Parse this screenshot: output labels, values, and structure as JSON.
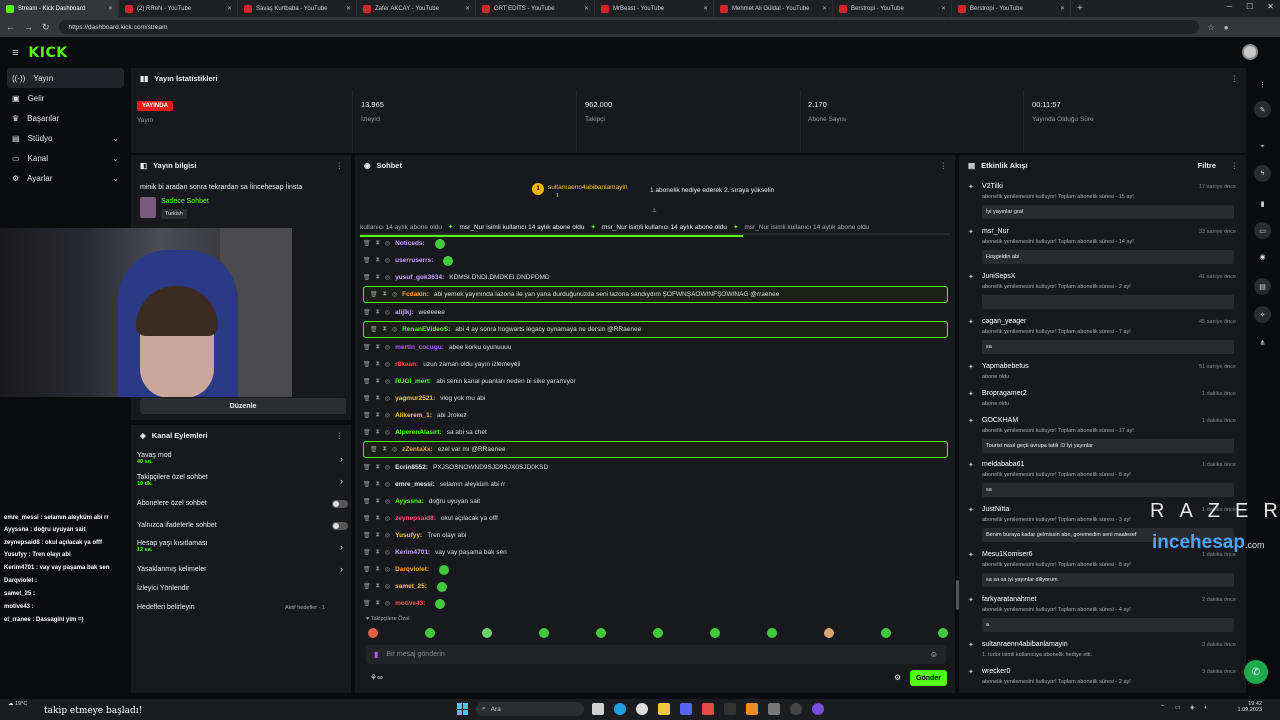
{
  "browser": {
    "tabs": [
      {
        "label": "Stream - Kick Dashboard",
        "active": true
      },
      {
        "label": "(2) RReN - YouTube"
      },
      {
        "label": "Savaş Kurtbaba - YouTube"
      },
      {
        "label": "Zafer AKCAY - YouTube"
      },
      {
        "label": "GRT EDİTS - YouTube"
      },
      {
        "label": "MrBeast - YouTube"
      },
      {
        "label": "Mehmet Ali Güldal - YouTube"
      },
      {
        "label": "Berstropi - YouTube"
      },
      {
        "label": "Berstropi - YouTube"
      }
    ],
    "url": "https://dashboard.kick.com/stream"
  },
  "app": {
    "logo": "KICK"
  },
  "sidebar": {
    "items": [
      {
        "label": "Yayın",
        "icon": "broadcast-icon"
      },
      {
        "label": "Gelir",
        "icon": "money-icon"
      },
      {
        "label": "Başarılar",
        "icon": "trophy-icon"
      },
      {
        "label": "Stüdyo",
        "icon": "studio-icon"
      },
      {
        "label": "Kanal",
        "icon": "channel-icon"
      },
      {
        "label": "Ayarlar",
        "icon": "settings-icon"
      }
    ]
  },
  "stats": {
    "title": "Yayın İstatistikleri",
    "live_badge": "YAYINDA",
    "live_label": "Yayın",
    "viewers": "13.965",
    "viewers_label": "İzleyici",
    "followers": "962.000",
    "followers_label": "Takipçi",
    "subs": "2.170",
    "subs_label": "Abone Sayısı",
    "uptime": "00:11:57",
    "uptime_label": "Yayında Olduğu Süre"
  },
  "stream_info": {
    "title": "Yayın bilgisi",
    "stream_title": "minik bi aradan sonra tekrardan sa İincehesap İinsta",
    "category": "Sadece Sohbet",
    "tag": "Turkish",
    "edit_button": "Düzenle"
  },
  "channel_actions": {
    "title": "Kanal Eylemleri",
    "items": [
      {
        "label": "Yavaş mod",
        "sub": "40 sn."
      },
      {
        "label": "Takipçilere özel sohbet",
        "sub": "10 dk."
      },
      {
        "label": "Abonelere özel sohbet",
        "sub": ""
      },
      {
        "label": "Yalnızca ifadelerle sohbet",
        "sub": ""
      },
      {
        "label": "Hesap yaşı kısıtlaması",
        "sub": "12 sa."
      },
      {
        "label": "Yasaklanmış kelimeler",
        "sub": ""
      },
      {
        "label": "İzleyici Yönlendir",
        "sub": ""
      },
      {
        "label": "Hedefleri belirleyin",
        "sub": ""
      }
    ],
    "goals_status": "Aktif hedefler · 1"
  },
  "chat": {
    "title": "Sohbet",
    "pinned_user": "sultanraenn4abibanlamayin",
    "pinned_count": "1",
    "pinned_text": "1 abonelik hediye ederek 2. sıraya yükselin",
    "ticker": [
      "kullanıcı 14 aylık abone oldu",
      "msr_Nur isimli kullanıcı 14 aylık abone oldu",
      "msr_Nur isimli kullanıcı 14 aylık abone oldu",
      "msr_Nur isimli kullanıcı 14 aylık abone oldu"
    ],
    "messages": [
      {
        "user": "Noticeds:",
        "text": "",
        "color": "#c9a2ff"
      },
      {
        "user": "userruserrs:",
        "text": "",
        "color": "#c9a2ff"
      },
      {
        "user": "yusuf_gok3634:",
        "text": "KDMSI.DNDI.DMDKEI.DNDPDMD",
        "color": "#c9a2ff"
      },
      {
        "user": "Fcdakin:",
        "text": "abi yemek yayınında lazona ile yan yana durduğunuzda seni lazona sandıydım ŞOFWNŞAOWINFŞOWINAG @rraenee",
        "color": "#f4a742",
        "hl": true
      },
      {
        "user": "alijlkj:",
        "text": "weeeeee",
        "color": "#c9a2ff"
      },
      {
        "user": "RenanEVideoS:",
        "text": "abi 4 ay sonra hogwarts legacy oynamaya ne dersin @RRaenee",
        "color": "#53fc18",
        "hl": true
      },
      {
        "user": "mertin_cocugu:",
        "text": "abee korku oyunuuuu",
        "color": "#b05cff"
      },
      {
        "user": "r8kaan:",
        "text": "uzun zaman oldu yayın izlemeyeli",
        "color": "#ff4d4d"
      },
      {
        "user": "RUGI_mert:",
        "text": "abi senin kanal puanları neden bi sike yaramıyor",
        "color": "#53fc18"
      },
      {
        "user": "yagmur2521:",
        "text": "vlog yok mu abi",
        "color": "#f4c542"
      },
      {
        "user": "Alikerem_1:",
        "text": "abi Jrokez",
        "color": "#f4c542"
      },
      {
        "user": "AlperenAlasirt:",
        "text": "sa abi sa chet",
        "color": "#53fc18"
      },
      {
        "user": "zZentaXx:",
        "text": "ezel var mı @RRaenee",
        "color": "#f4a742",
        "hl": true
      },
      {
        "user": "Ecrin8552:",
        "text": "PXJSOSNOWND9SJD9SJX0SJD0KSD",
        "color": "#e8e8e8"
      },
      {
        "user": "emre_messi:",
        "text": "selamın aleyküm abi rr",
        "color": "#e8e8e8"
      },
      {
        "user": "Ayyssna:",
        "text": "doğru uyuyan sait",
        "color": "#53fc18"
      },
      {
        "user": "zeynepsaid8:",
        "text": "okul açılacak ya offf",
        "color": "#ff4d7a"
      },
      {
        "user": "Yusufyy:",
        "text": "Tren olayı abi",
        "color": "#f4c542"
      },
      {
        "user": "Kerim4701:",
        "text": "vay vay paşama bak sen",
        "color": "#c9a2ff"
      },
      {
        "user": "Darqviolet:",
        "text": "",
        "color": "#f4a742"
      },
      {
        "user": "samet_25:",
        "text": "",
        "color": "#f4c542"
      },
      {
        "user": "motive43:",
        "text": "",
        "color": "#ff4d4d"
      }
    ],
    "followers_only": "Takipçilere Özel",
    "input_placeholder": "Bir mesaj gönderin",
    "send_button": "Gönder"
  },
  "events": {
    "title": "Etkinlik Akışı",
    "filter": "Filtre",
    "items": [
      {
        "name": "V2Tilki",
        "time": "17 saniye önce",
        "desc": "abonelik yenilemesini kutluyor! Toplam abonelik süresi - 15 ay!",
        "msg": "İyi yayınlar gral"
      },
      {
        "name": "msr_Nur",
        "time": "33 saniye önce",
        "desc": "abonelik yenilemesini kutluyor! Toplam abonelik süresi - 14 ay!",
        "msg": "Hoşgeldin abi"
      },
      {
        "name": "JuniSepsX",
        "time": "41 saniye önce",
        "desc": "abonelik yenilemesini kutluyor! Toplam abonelik süresi - 2 ay!",
        "msg": ""
      },
      {
        "name": "cagan_yeager",
        "time": "45 saniye önce",
        "desc": "abonelik yenilemesini kutluyor! Toplam abonelik süresi - 7 ay!",
        "msg": "sa"
      },
      {
        "name": "Yapmabebetus",
        "time": "51 saniye önce",
        "desc": "abone oldu",
        "msg": ""
      },
      {
        "name": "Bropragamer2",
        "time": "1 dakika önce",
        "desc": "abone oldu",
        "msg": ""
      },
      {
        "name": "GOCKHAM",
        "time": "1 dakika önce",
        "desc": "abonelik yenilemesini kutluyor! Toplam abonelik süresi - 17 ay!",
        "msg": "Tourist nasıl geçti avrupa tatili :D İyi yayınlar"
      },
      {
        "name": "meldababa61",
        "time": "1 dakika önce",
        "desc": "abonelik yenilemesini kutluyor! Toplam abonelik süresi - 8 ay!",
        "msg": "sa"
      },
      {
        "name": "JustNitta",
        "time": "1 dakika önce",
        "desc": "abonelik yenilemesini kutluyor! Toplam abonelik süresi - 3 ay!",
        "msg": "Benim buraya kadar gelmissin abe, goremedim seni maalesef"
      },
      {
        "name": "Mesu1Komiser6",
        "time": "1 dakika önce",
        "desc": "abonelik yenilemesini kutluyor! Toplam abonelik süresi - 8 ay!",
        "msg": "sa sa sa iyi yayınlar diliyorum"
      },
      {
        "name": "farkyaratanahmet",
        "time": "2 dakika önce",
        "desc": "abonelik yenilemesini kutluyor! Toplam abonelik süresi - 4 ay!",
        "msg": "a"
      },
      {
        "name": "sultanraenn4abibanlamayin",
        "time": "3 dakika önce",
        "desc": "1. tudor isimli kullanıcıya abonelik hediye etti.",
        "msg": ""
      },
      {
        "name": "wrecker0",
        "time": "3 dakika önce",
        "desc": "abonelik yenilemesini kutluyor! Toplam abonelik süresi - 2 ay!",
        "msg": ""
      }
    ]
  },
  "overlay": {
    "chat": [
      "emre_messi : selamın aleyküm abi rr",
      "Ayyssna : doğru uyuyan sait",
      "zeynepsaid8 : okul açılacak ya offf",
      "Yusufyy : Tren olayı abi",
      "Kerim4701 : vay vay paşama bak sen",
      "Darqviolet :",
      "samet_25 :",
      "motive43 :",
      "el_rranee : Dassagini yim =)"
    ],
    "sponsor1": "RAZER",
    "sponsor2": "incehesap",
    "sponsor2_suffix": ".com",
    "follow_toast": "takip etmeye başladı!",
    "weather": "19°C"
  },
  "taskbar": {
    "search": "Ara",
    "time": "19:42",
    "date": "1.09.2023"
  },
  "colors": {
    "accent": "#53fc18",
    "live": "#e91916",
    "panel": "#18191c"
  }
}
